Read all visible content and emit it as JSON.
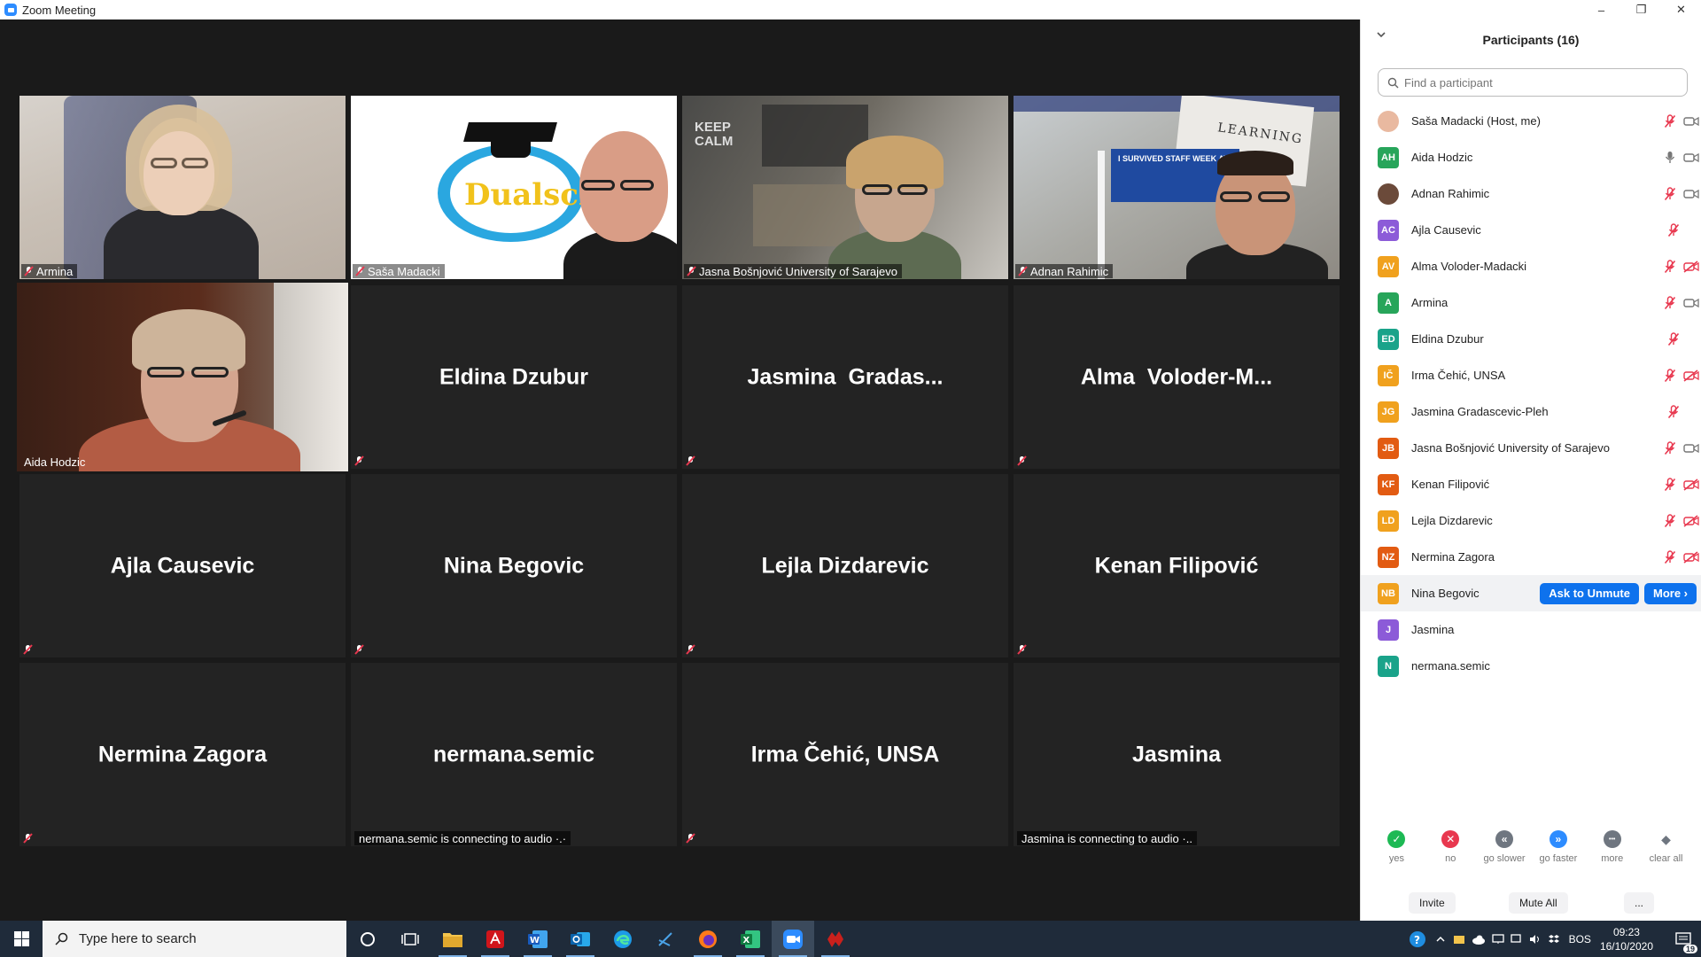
{
  "window": {
    "title": "Zoom Meeting",
    "controls": {
      "minimize": "–",
      "restore": "❐",
      "close": "✕"
    }
  },
  "gallery": {
    "video_tiles": [
      {
        "label": "Armina"
      },
      {
        "label": "Saša Madacki",
        "logo_text": "Dualsci"
      },
      {
        "label": "Jasna Bošnjović University of Sarajevo",
        "poster_text": "KEEP CALM"
      },
      {
        "label": "Adnan Rahimic",
        "banner_text": "I SURVIVED STAFF WEEK AT",
        "sign_text": "LEARNING"
      },
      {
        "label": "Aida Hodzic"
      }
    ],
    "name_tiles": [
      {
        "display": "Eldina Dzubur"
      },
      {
        "display": "Jasmina  Gradas..."
      },
      {
        "display": "Alma  Voloder-M..."
      },
      {
        "display": "Ajla Causevic"
      },
      {
        "display": "Nina Begovic"
      },
      {
        "display": "Lejla Dizdarevic"
      },
      {
        "display": "Kenan Filipović"
      },
      {
        "display": "Nermina Zagora"
      },
      {
        "display": "nermana.semic",
        "status": "nermana.semic is connecting to audio ·.·"
      },
      {
        "display": "Irma Čehić, UNSA"
      },
      {
        "display": "Jasmina",
        "status": "Jasmina is connecting to audio ·.."
      }
    ]
  },
  "participants": {
    "title": "Participants (16)",
    "search_placeholder": "Find a participant",
    "list": [
      {
        "initials": "",
        "name": "Saša Madacki (Host, me)",
        "color": "#e9b9a0",
        "mic": "off",
        "video": "on"
      },
      {
        "initials": "AH",
        "name": "Aida Hodzic",
        "color": "#27a55a",
        "mic": "on",
        "video": "on"
      },
      {
        "initials": "",
        "name": "Adnan Rahimic",
        "color": "#6b4a3a",
        "mic": "off",
        "video": "on"
      },
      {
        "initials": "AC",
        "name": "Ajla Causevic",
        "color": "#8c5bd8",
        "mic": "off",
        "video": "none"
      },
      {
        "initials": "AV",
        "name": "Alma Voloder-Madacki",
        "color": "#f0a11e",
        "mic": "off",
        "video": "off"
      },
      {
        "initials": "A",
        "name": "Armina",
        "color": "#27a55a",
        "mic": "off",
        "video": "on"
      },
      {
        "initials": "ED",
        "name": "Eldina Dzubur",
        "color": "#1aa38a",
        "mic": "off",
        "video": "none"
      },
      {
        "initials": "IČ",
        "name": "Irma Čehić, UNSA",
        "color": "#f0a11e",
        "mic": "off",
        "video": "off"
      },
      {
        "initials": "JG",
        "name": "Jasmina Gradascevic-Pleh",
        "color": "#f0a11e",
        "mic": "off",
        "video": "none"
      },
      {
        "initials": "JB",
        "name": "Jasna Bošnjović University of Sarajevo",
        "color": "#e25b12",
        "mic": "off",
        "video": "on"
      },
      {
        "initials": "KF",
        "name": "Kenan Filipović",
        "color": "#e25b12",
        "mic": "off",
        "video": "off"
      },
      {
        "initials": "LD",
        "name": "Lejla Dizdarevic",
        "color": "#f0a11e",
        "mic": "off",
        "video": "off"
      },
      {
        "initials": "NZ",
        "name": "Nermina Zagora",
        "color": "#e25b12",
        "mic": "off",
        "video": "off"
      },
      {
        "initials": "NB",
        "name": "Nina Begovic",
        "color": "#f0a11e",
        "mic": "",
        "video": ""
      },
      {
        "initials": "J",
        "name": "Jasmina",
        "color": "#8c5bd8",
        "mic": "",
        "video": ""
      },
      {
        "initials": "N",
        "name": "nermana.semic",
        "color": "#1aa38a",
        "mic": "",
        "video": ""
      }
    ],
    "hover_actions": {
      "ask_to_unmute": "Ask to Unmute",
      "more": "More ›"
    },
    "reactions": [
      {
        "label": "yes",
        "symbol": "✓",
        "color": "#1db954"
      },
      {
        "label": "no",
        "symbol": "✕",
        "color": "#e8384f"
      },
      {
        "label": "go slower",
        "symbol": "«",
        "color": "#6f7680"
      },
      {
        "label": "go faster",
        "symbol": "»",
        "color": "#2d8cff"
      },
      {
        "label": "more",
        "symbol": "•••",
        "color": "#6f7680"
      },
      {
        "label": "clear all",
        "symbol": "◆",
        "color": "#6f7680"
      }
    ],
    "buttons": {
      "invite": "Invite",
      "mute_all": "Mute All",
      "more": "..."
    }
  },
  "taskbar": {
    "search_placeholder": "Type here to search",
    "apps": [
      "cortana",
      "task-view",
      "file-explorer",
      "acrobat",
      "word",
      "outlook",
      "edge",
      "snipping",
      "firefox",
      "excel",
      "zoom",
      "app-red"
    ],
    "tray": {
      "language": "BOS",
      "time": "09:23",
      "date": "16/10/2020",
      "notifications": "19"
    }
  },
  "colors": {
    "zoom_blue": "#2d8cff",
    "action_blue": "#0e72ed",
    "mute_red": "#e8384f",
    "active_speaker": "#d8e63a"
  }
}
